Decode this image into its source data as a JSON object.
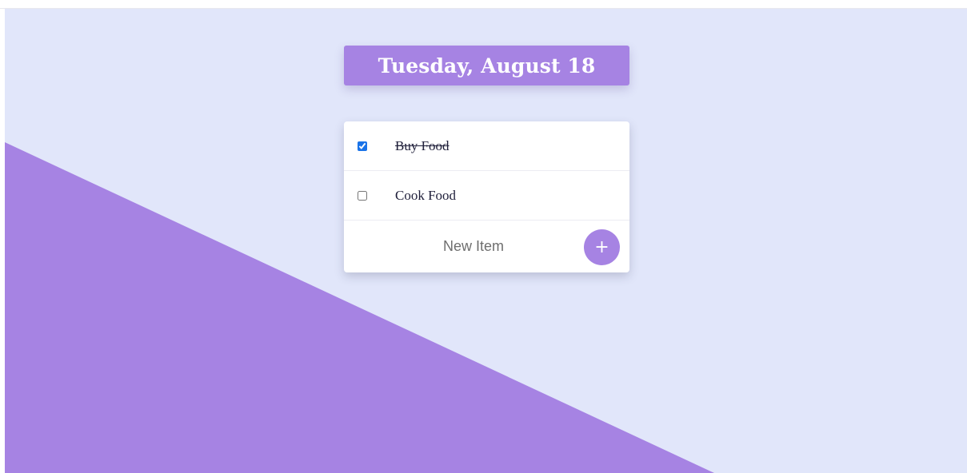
{
  "header": {
    "date_title": "Tuesday, August 18"
  },
  "todo": {
    "items": [
      {
        "label": "Buy Food",
        "checked": true
      },
      {
        "label": "Cook Food",
        "checked": false
      }
    ],
    "new_item": {
      "placeholder": "New Item",
      "value": ""
    },
    "add_button": {
      "icon": "plus-icon",
      "label": "+"
    }
  },
  "colors": {
    "background": "#e1e6fa",
    "accent": "#a683e3",
    "card": "#ffffff"
  }
}
